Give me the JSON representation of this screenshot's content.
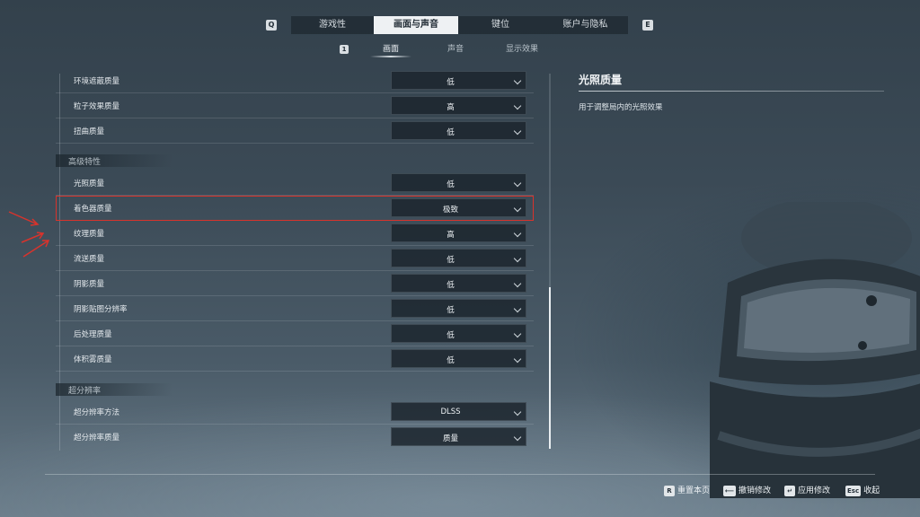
{
  "top_tabs": {
    "prev_key": "Q",
    "next_key": "E",
    "items": [
      {
        "label": "游戏性",
        "active": false
      },
      {
        "label": "画面与声音",
        "active": true
      },
      {
        "label": "键位",
        "active": false
      },
      {
        "label": "账户与隐私",
        "active": false
      }
    ]
  },
  "sub_tabs": {
    "prev_key": "1",
    "items": [
      {
        "label": "画面",
        "active": true
      },
      {
        "label": "声音",
        "active": false
      },
      {
        "label": "显示效果",
        "active": false
      }
    ]
  },
  "settings": {
    "group1": [
      {
        "label": "环境遮蔽质量",
        "value": "低"
      },
      {
        "label": "粒子效果质量",
        "value": "高"
      },
      {
        "label": "扭曲质量",
        "value": "低"
      }
    ],
    "section_advanced": "高级特性",
    "group2": [
      {
        "label": "光照质量",
        "value": "低"
      },
      {
        "label": "着色器质量",
        "value": "极致"
      },
      {
        "label": "纹理质量",
        "value": "高"
      },
      {
        "label": "流送质量",
        "value": "低"
      },
      {
        "label": "阴影质量",
        "value": "低"
      },
      {
        "label": "阴影贴图分辨率",
        "value": "低"
      },
      {
        "label": "后处理质量",
        "value": "低"
      },
      {
        "label": "体积雾质量",
        "value": "低"
      }
    ],
    "section_superres": "超分辨率",
    "group3": [
      {
        "label": "超分辨率方法",
        "value": "DLSS"
      },
      {
        "label": "超分辨率质量",
        "value": "质量"
      }
    ]
  },
  "info": {
    "title": "光照质量",
    "description": "用于调整局内的光照效果"
  },
  "footer": {
    "reset": {
      "key": "R",
      "label": "重置本页"
    },
    "undo": {
      "key": "⟵",
      "label": "撤销修改"
    },
    "apply": {
      "key": "↵",
      "label": "应用修改"
    },
    "close": {
      "key": "Esc",
      "label": "收起"
    }
  },
  "colors": {
    "highlight": "#d8332c",
    "active_tab_bg": "#eef1f3"
  }
}
